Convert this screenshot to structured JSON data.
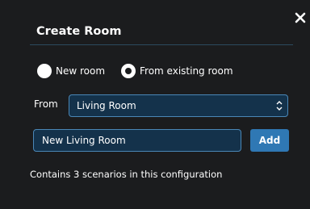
{
  "dialog": {
    "title": "Create Room",
    "close_icon": "close-icon",
    "radio_options": [
      {
        "label": "New room",
        "selected": false
      },
      {
        "label": "From existing room",
        "selected": true
      }
    ],
    "from_label": "From",
    "from_select": {
      "value": "Living Room",
      "icon": "select-caret-icon"
    },
    "name_input": {
      "value": "New Living Room"
    },
    "add_label": "Add",
    "info_text": "Contains 3 scenarios in this configuration"
  },
  "colors": {
    "background": "#1b1c1e",
    "field_background": "#14324b",
    "field_border": "#4a87b7",
    "button": "#2f78b4",
    "divider": "#2c4a5f",
    "text": "#ffffff"
  }
}
